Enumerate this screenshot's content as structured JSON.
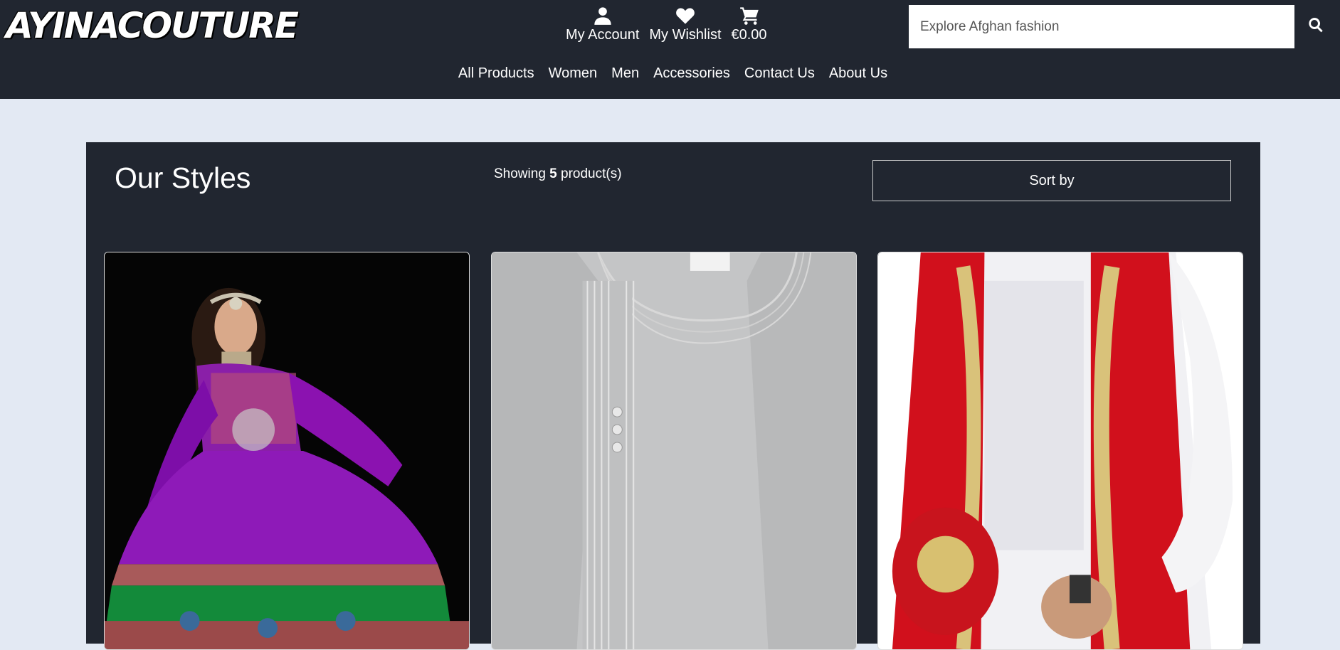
{
  "header": {
    "logo_text": "AYINACOUTURE",
    "account_label": "My Account",
    "account_icon": "user-icon",
    "wishlist_label": "My Wishlist",
    "wishlist_icon": "heart-icon",
    "cart_total": "€0.00",
    "cart_icon": "cart-icon",
    "search_placeholder": "Explore Afghan fashion",
    "search_icon": "search-icon"
  },
  "nav": {
    "items": [
      "All Products",
      "Women",
      "Men",
      "Accessories",
      "Contact Us",
      "About Us"
    ]
  },
  "main": {
    "title": "Our Styles",
    "count_prefix": "Showing ",
    "count_value": "5",
    "count_suffix": " product(s)",
    "sort_label": "Sort by"
  },
  "products": [
    {
      "image": "woman in purple and green embroidered Afghan dress"
    },
    {
      "image": "grey embroidered men's kameez"
    },
    {
      "image": "white shirt with red embroidered vest"
    }
  ],
  "colors": {
    "header_bg": "#212630",
    "page_bg": "#e3e9f3",
    "panel_bg": "#212630"
  }
}
